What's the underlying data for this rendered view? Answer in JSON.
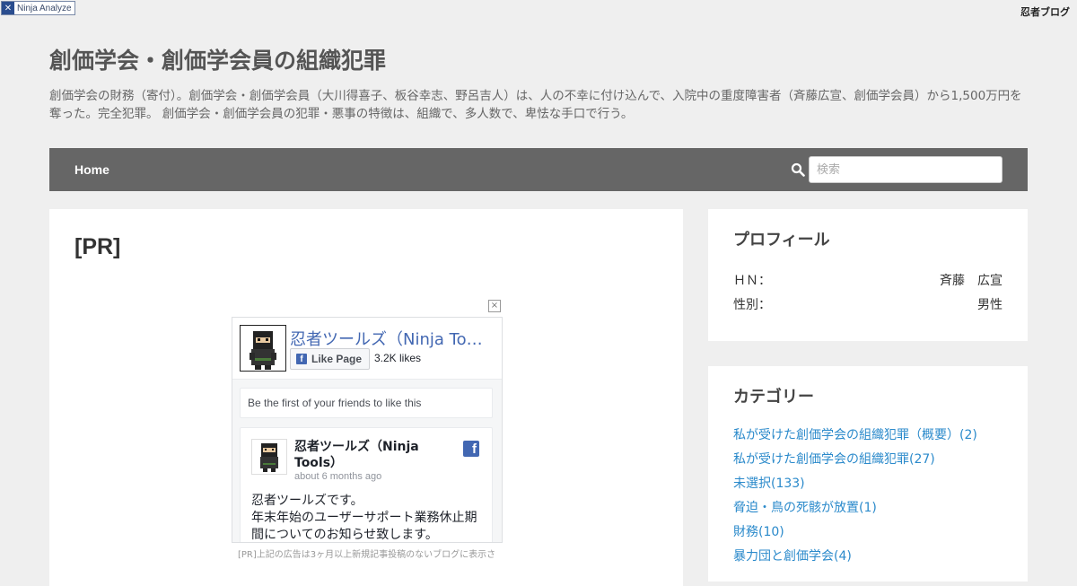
{
  "header": {
    "badge_label": "Ninja Analyze",
    "logo_text": "忍者ブログ",
    "site_title": "創価学会・創価学会員の組織犯罪",
    "site_description": "創価学会の財務（寄付）。創価学会・創価学会員（大川得喜子、板谷幸志、野呂吉人）は、人の不幸に付け込んで、入院中の重度障害者（斉藤広宣、創価学会員）から1,500万円を奪った。完全犯罪。 創価学会・創価学会員の犯罪・悪事の特徴は、組織で、多人数で、卑怯な手口で行う。"
  },
  "nav": {
    "home_label": "Home",
    "search_placeholder": "検索"
  },
  "main": {
    "post_title": "[PR]",
    "close_symbol": "×",
    "fb_widget": {
      "page_name": "忍者ツールズ（Ninja Tools）",
      "like_button_label": "Like Page",
      "likes_count": "3.2K likes",
      "friends_text": "Be the first of your friends to like this",
      "post_author": "忍者ツールズ（Ninja Tools）",
      "post_time": "about 6 months ago",
      "post_text_line1": "忍者ツールズです。",
      "post_text_line2": "年末年始のユーザーサポート業務休止期間についてのお知らせ致します。"
    },
    "pr_note": "[PR]上記の広告は3ヶ月以上新規記事投稿のないブログに表示さ"
  },
  "sidebar": {
    "profile": {
      "title": "プロフィール",
      "rows": [
        {
          "label": "ＨＮ：",
          "value": "斉藤　広宣"
        },
        {
          "label": "性別：",
          "value": "男性"
        }
      ]
    },
    "category": {
      "title": "カテゴリー",
      "items": [
        "私が受けた創価学会の組織犯罪（概要）(2)",
        "私が受けた創価学会の組織犯罪(27)",
        "未選択(133)",
        "脅迫・鳥の死骸が放置(1)",
        "財務(10)",
        "暴力団と創価学会(4)"
      ]
    }
  },
  "colors": {
    "nav_bg": "#666666",
    "link": "#2b8acb",
    "fb_blue": "#4267b2"
  }
}
